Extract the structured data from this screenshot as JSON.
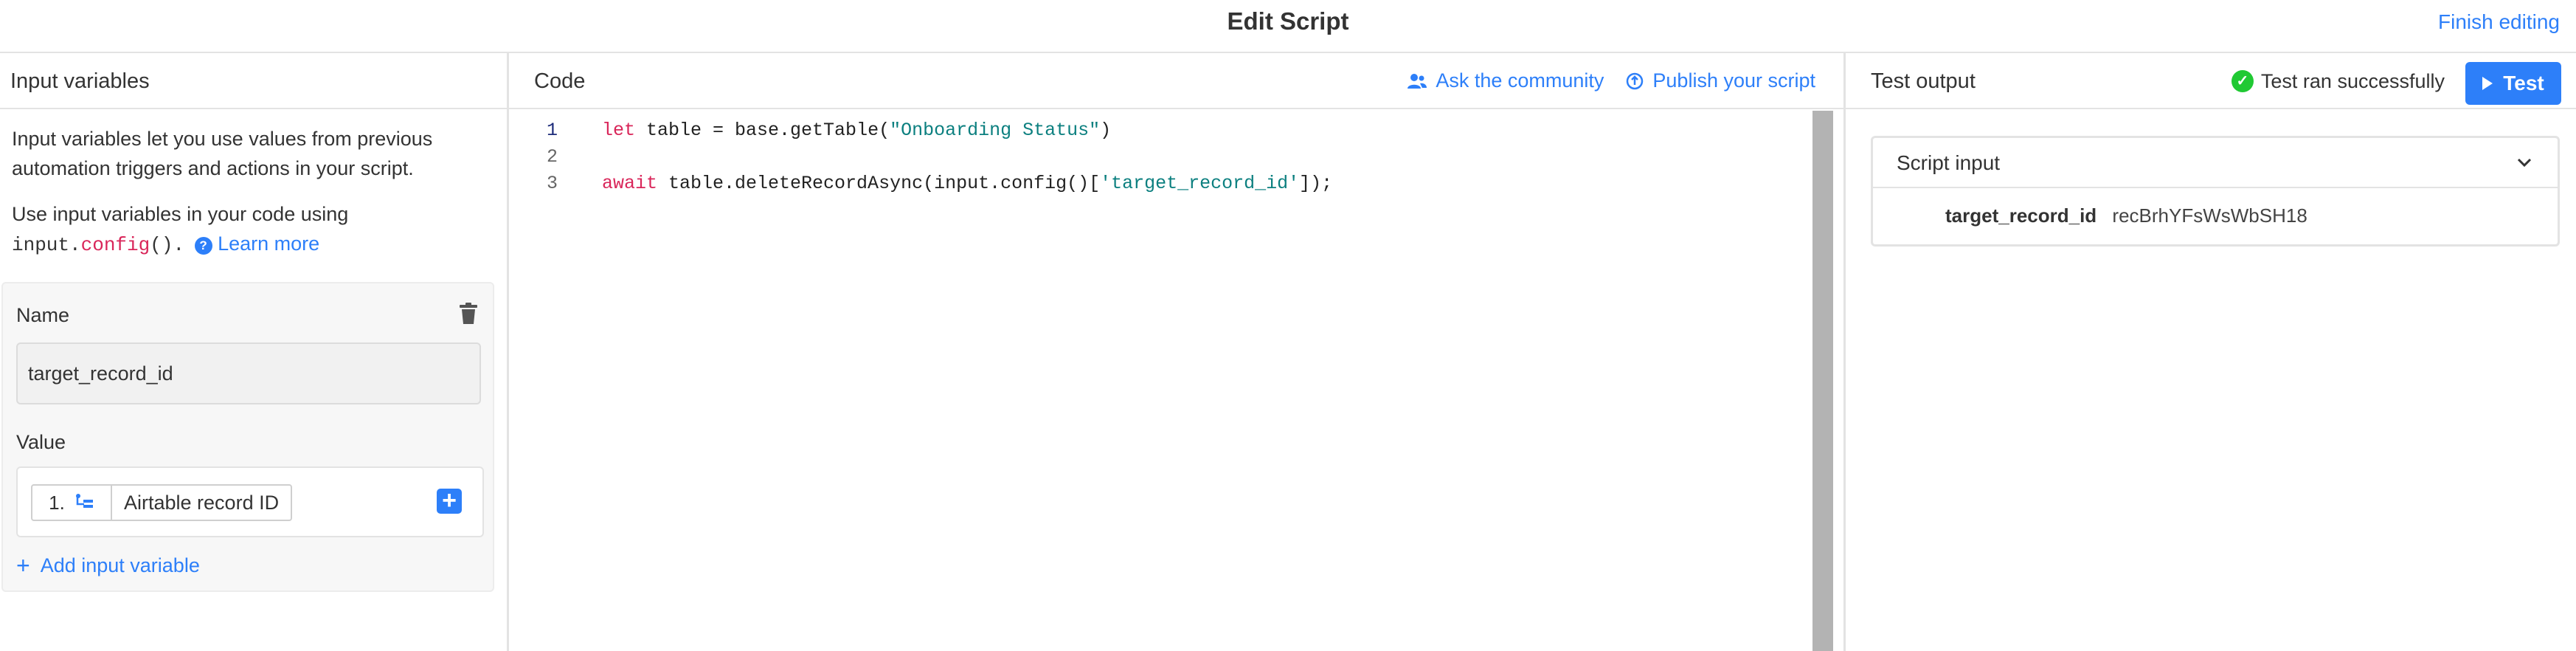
{
  "header": {
    "title": "Edit Script",
    "finish_label": "Finish editing"
  },
  "input_panel": {
    "title": "Input variables",
    "description": "Input variables let you use values from previous automation triggers and actions in your script.",
    "usage_prefix": "Use input variables in your code using",
    "usage_code_obj": "input.",
    "usage_code_fn": "config",
    "usage_code_end": "().",
    "learn_more": "Learn more",
    "variable": {
      "name_label": "Name",
      "name_value": "target_record_id",
      "value_label": "Value",
      "token_step": "1.",
      "token_field": "Airtable record ID"
    },
    "add_variable": "Add input variable"
  },
  "code_panel": {
    "title": "Code",
    "ask_community": "Ask the community",
    "publish": "Publish your script",
    "lines": [
      {
        "num": "1",
        "kw": "let",
        "text": " table = base.getTable(",
        "str": "\"Onboarding Status\"",
        "tail": ")"
      },
      {
        "num": "2",
        "kw": "",
        "text": "",
        "str": "",
        "tail": ""
      },
      {
        "num": "3",
        "kw": "await",
        "text": " table.deleteRecordAsync(input.config()[",
        "str": "'target_record_id'",
        "tail": "]);"
      }
    ]
  },
  "output_panel": {
    "title": "Test output",
    "status": "Test ran successfully",
    "test_label": "Test",
    "script_input_title": "Script input",
    "input_key": "target_record_id",
    "input_value": "recBrhYFsWsWbSH18"
  },
  "colors": {
    "accent": "#2d7ff9",
    "success": "#20c933",
    "keyword": "#d9265a",
    "string": "#0b7f7f"
  }
}
